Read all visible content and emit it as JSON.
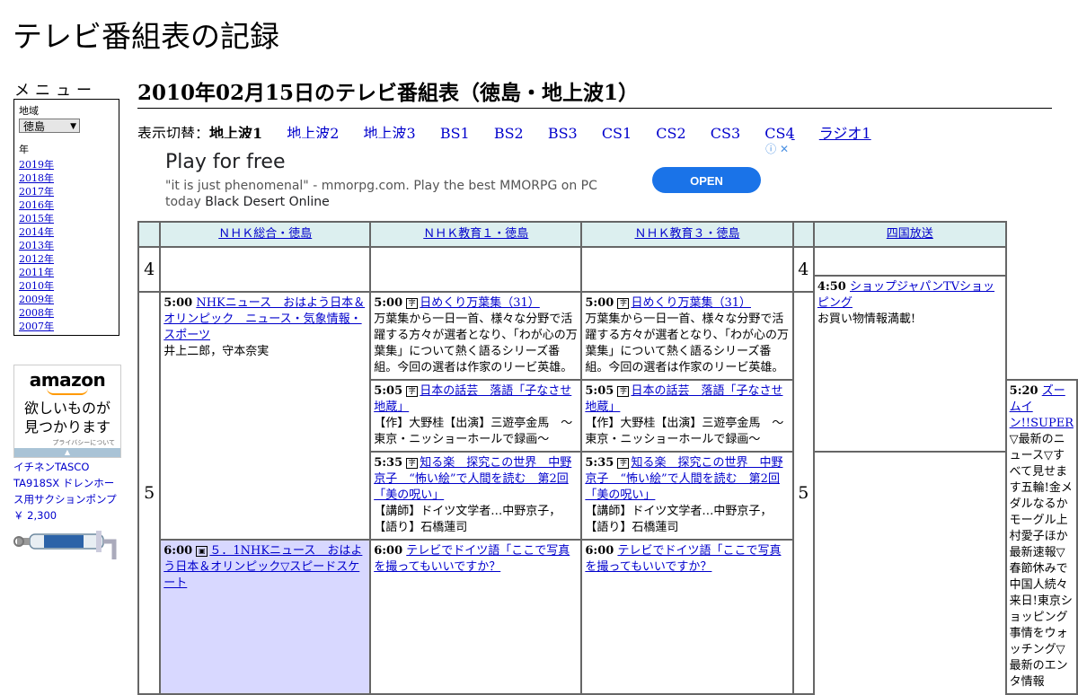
{
  "site": {
    "title": "テレビ番組表の記録"
  },
  "menu": {
    "label": "メニュー",
    "region_label": "地域",
    "region_value": "徳島",
    "year_label": "年",
    "years": [
      "2019年",
      "2018年",
      "2017年",
      "2016年",
      "2015年",
      "2014年",
      "2013年",
      "2012年",
      "2011年",
      "2010年",
      "2009年",
      "2008年",
      "2007年"
    ]
  },
  "amazon_ad": {
    "brand": "amazon",
    "tagline_1": "欲しいものが",
    "tagline_2": "見つかります",
    "privacy": "プライバシーについて"
  },
  "product": {
    "name": "イチネンTASCO TA918SX ドレンホース用サクションポンプ",
    "price": "￥ 2,300"
  },
  "page": {
    "heading": "2010年02月15日のテレビ番組表（徳島・地上波1）"
  },
  "switcher": {
    "label": "表示切替：",
    "current": "地上波1",
    "links": [
      "地上波2",
      "地上波3",
      "BS1",
      "BS2",
      "BS3",
      "CS1",
      "CS2",
      "CS3",
      "CS4",
      "ラジオ1"
    ]
  },
  "banner_ad": {
    "title": "Play for free",
    "desc": "\"it is just phenomenal\" - mmorpg.com. Play the best MMORPG on PC today",
    "desc_brand": "Black Desert Online",
    "button": "OPEN"
  },
  "channels": [
    "ＮＨＫ総合・徳島",
    "ＮＨＫ教育１・徳島",
    "ＮＨＫ教育３・徳島",
    "四国放送"
  ],
  "hours": [
    "4",
    "5"
  ],
  "programs": {
    "nhk_5_00": {
      "time": "5:00",
      "title": "NHKニュース　おはよう日本＆オリンピック　ニュース・気象情報・スポーツ",
      "desc": "井上二郎，守本奈実"
    },
    "nhk_6_00": {
      "time": "6:00",
      "title": "５．1NHKニュース　おはよう日本＆オリンピック▽スピードスケート"
    },
    "edu1_5_00": {
      "time": "5:00",
      "title": "日めくり万葉集（31）",
      "desc": "万葉集から一日一首、様々な分野で活躍する方々が選者となり、「わが心の万葉集」について熱く語るシリーズ番組。今回の選者は作家のリービ英雄。"
    },
    "edu1_5_05": {
      "time": "5:05",
      "title": "日本の話芸　落語「子なさせ地蔵」",
      "desc": "【作】大野桂【出演】三遊亭金馬　～東京・ニッショーホールで録画～"
    },
    "edu1_5_35": {
      "time": "5:35",
      "title": "知る楽　探究この世界　中野京子　“怖い絵”で人間を読む　第2回「美の呪い」",
      "desc": "【講師】ドイツ文学者…中野京子，【語り】石橋蓮司"
    },
    "edu1_6_00": {
      "time": "6:00",
      "title": "テレビでドイツ語「ここで写真を撮ってもいいですか？"
    },
    "edu3_5_00": {
      "time": "5:00",
      "title": "日めくり万葉集（31）",
      "desc": "万葉集から一日一首、様々な分野で活躍する方々が選者となり、「わが心の万葉集」について熱く語るシリーズ番組。今回の選者は作家のリービ英雄。"
    },
    "edu3_5_05": {
      "time": "5:05",
      "title": "日本の話芸　落語「子なさせ地蔵」",
      "desc": "【作】大野桂【出演】三遊亭金馬　～東京・ニッショーホールで録画～"
    },
    "edu3_5_35": {
      "time": "5:35",
      "title": "知る楽　探究この世界　中野京子　“怖い絵”で人間を読む　第2回「美の呪い」",
      "desc": "【講師】ドイツ文学者…中野京子，【語り】石橋蓮司"
    },
    "edu3_6_00": {
      "time": "6:00",
      "title": "テレビでドイツ語「ここで写真を撮ってもいいですか？"
    },
    "jrt_4_50": {
      "time": "4:50",
      "title": "ショップジャパンTVショッピング",
      "desc": "お買い物情報満載!"
    },
    "jrt_5_20": {
      "time": "5:20",
      "title": "ズームイン!!SUPER",
      "desc": "▽最新のニュース▽すべて見せます五輪!金メダルなるかモーグル上村愛子ほか最新速報▽春節休みで中国人続々来日!東京ショッピング事情をウォッチング▽最新のエンタ情報"
    }
  },
  "colors": {
    "link": "#0000cc",
    "channel_header_bg": "#dcefef",
    "highlight_bg": "#d8d8ff",
    "open_button": "#1a73e8"
  }
}
